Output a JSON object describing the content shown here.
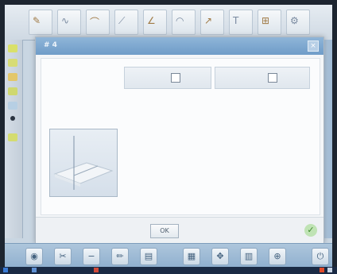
{
  "dialog": {
    "title": "# 4",
    "close_glyph": "×",
    "ok_label": "OK",
    "confirm_glyph": "✓"
  },
  "colors": {
    "title_bar": "#7ea9d0",
    "toolbar": "#dbe3eb",
    "bottom_bar": "#9fbbd6",
    "taskbar": "#1a2a44"
  },
  "toolbar": {
    "tools": [
      {
        "icon": "pen-icon",
        "glyph": "✎"
      },
      {
        "icon": "curve-icon",
        "glyph": "∿"
      },
      {
        "icon": "shape-icon",
        "glyph": "⌒"
      },
      {
        "icon": "line-icon",
        "glyph": "⟋"
      },
      {
        "icon": "angle-icon",
        "glyph": "∠"
      },
      {
        "icon": "arc-icon",
        "glyph": "◠"
      },
      {
        "icon": "arrow-icon",
        "glyph": "↗"
      },
      {
        "icon": "text-icon",
        "glyph": "T"
      },
      {
        "icon": "grid-icon",
        "glyph": "⊞"
      },
      {
        "icon": "settings-icon",
        "glyph": "⚙"
      }
    ]
  },
  "bottombar": {
    "tools": [
      {
        "icon": "globe-icon",
        "glyph": "◉"
      },
      {
        "icon": "scissors-icon",
        "glyph": "✂"
      },
      {
        "icon": "minus-icon",
        "glyph": "−"
      },
      {
        "icon": "pencil-icon",
        "glyph": "✏"
      },
      {
        "icon": "page-icon",
        "glyph": "▤"
      },
      {
        "icon": "image-icon",
        "glyph": "▦"
      },
      {
        "icon": "tools-icon",
        "glyph": "✥"
      },
      {
        "icon": "table-icon",
        "glyph": "▥"
      },
      {
        "icon": "measure-icon",
        "glyph": "⊕"
      },
      {
        "icon": "exit-icon",
        "glyph": "⏻"
      }
    ]
  },
  "taskbar": {
    "items": [
      "",
      "",
      ""
    ]
  }
}
